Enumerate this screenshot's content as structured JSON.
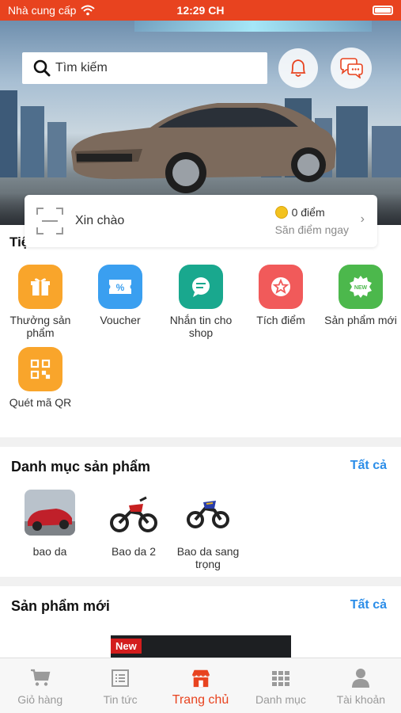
{
  "status_bar": {
    "carrier": "Nhà cung cấp",
    "time": "12:29 CH"
  },
  "search": {
    "placeholder": "Tìm kiếm"
  },
  "greeting": {
    "hello": "Xin chào",
    "points": "0 điểm",
    "hunt": "Săn điểm ngay"
  },
  "utilities": {
    "title": "Tiện ích của tôi",
    "items": [
      {
        "label": "Thưởng sản phẩm",
        "icon": "gift-icon",
        "color": "#f9a52b"
      },
      {
        "label": "Voucher",
        "icon": "voucher-icon",
        "color": "#3a9ff0"
      },
      {
        "label": "Nhắn tin cho shop",
        "icon": "chat-icon",
        "color": "#19a88e"
      },
      {
        "label": "Tích điểm",
        "icon": "star-icon",
        "color": "#f15a5a"
      },
      {
        "label": "Sản phẩm mới",
        "icon": "new-badge-icon",
        "color": "#4cb84c"
      },
      {
        "label": "Quét mã QR",
        "icon": "qr-icon",
        "color": "#f9a52b"
      }
    ]
  },
  "categories": {
    "title": "Danh mục sản phẩm",
    "see_all": "Tất cả",
    "items": [
      {
        "label": "bao da"
      },
      {
        "label": "Bao da 2"
      },
      {
        "label": "Bao da sang trọng"
      }
    ]
  },
  "new_products": {
    "title": "Sản phẩm mới",
    "see_all": "Tất cả",
    "tag": "New"
  },
  "tabs": [
    {
      "label": "Giỏ hàng",
      "icon": "cart-icon"
    },
    {
      "label": "Tin tức",
      "icon": "news-icon"
    },
    {
      "label": "Trang chủ",
      "icon": "home-icon",
      "active": true
    },
    {
      "label": "Danh mục",
      "icon": "grid-icon"
    },
    {
      "label": "Tài khoản",
      "icon": "user-icon"
    }
  ],
  "colors": {
    "primary": "#e8431f",
    "link": "#2b8de8",
    "inactive": "#9a9a9a"
  }
}
